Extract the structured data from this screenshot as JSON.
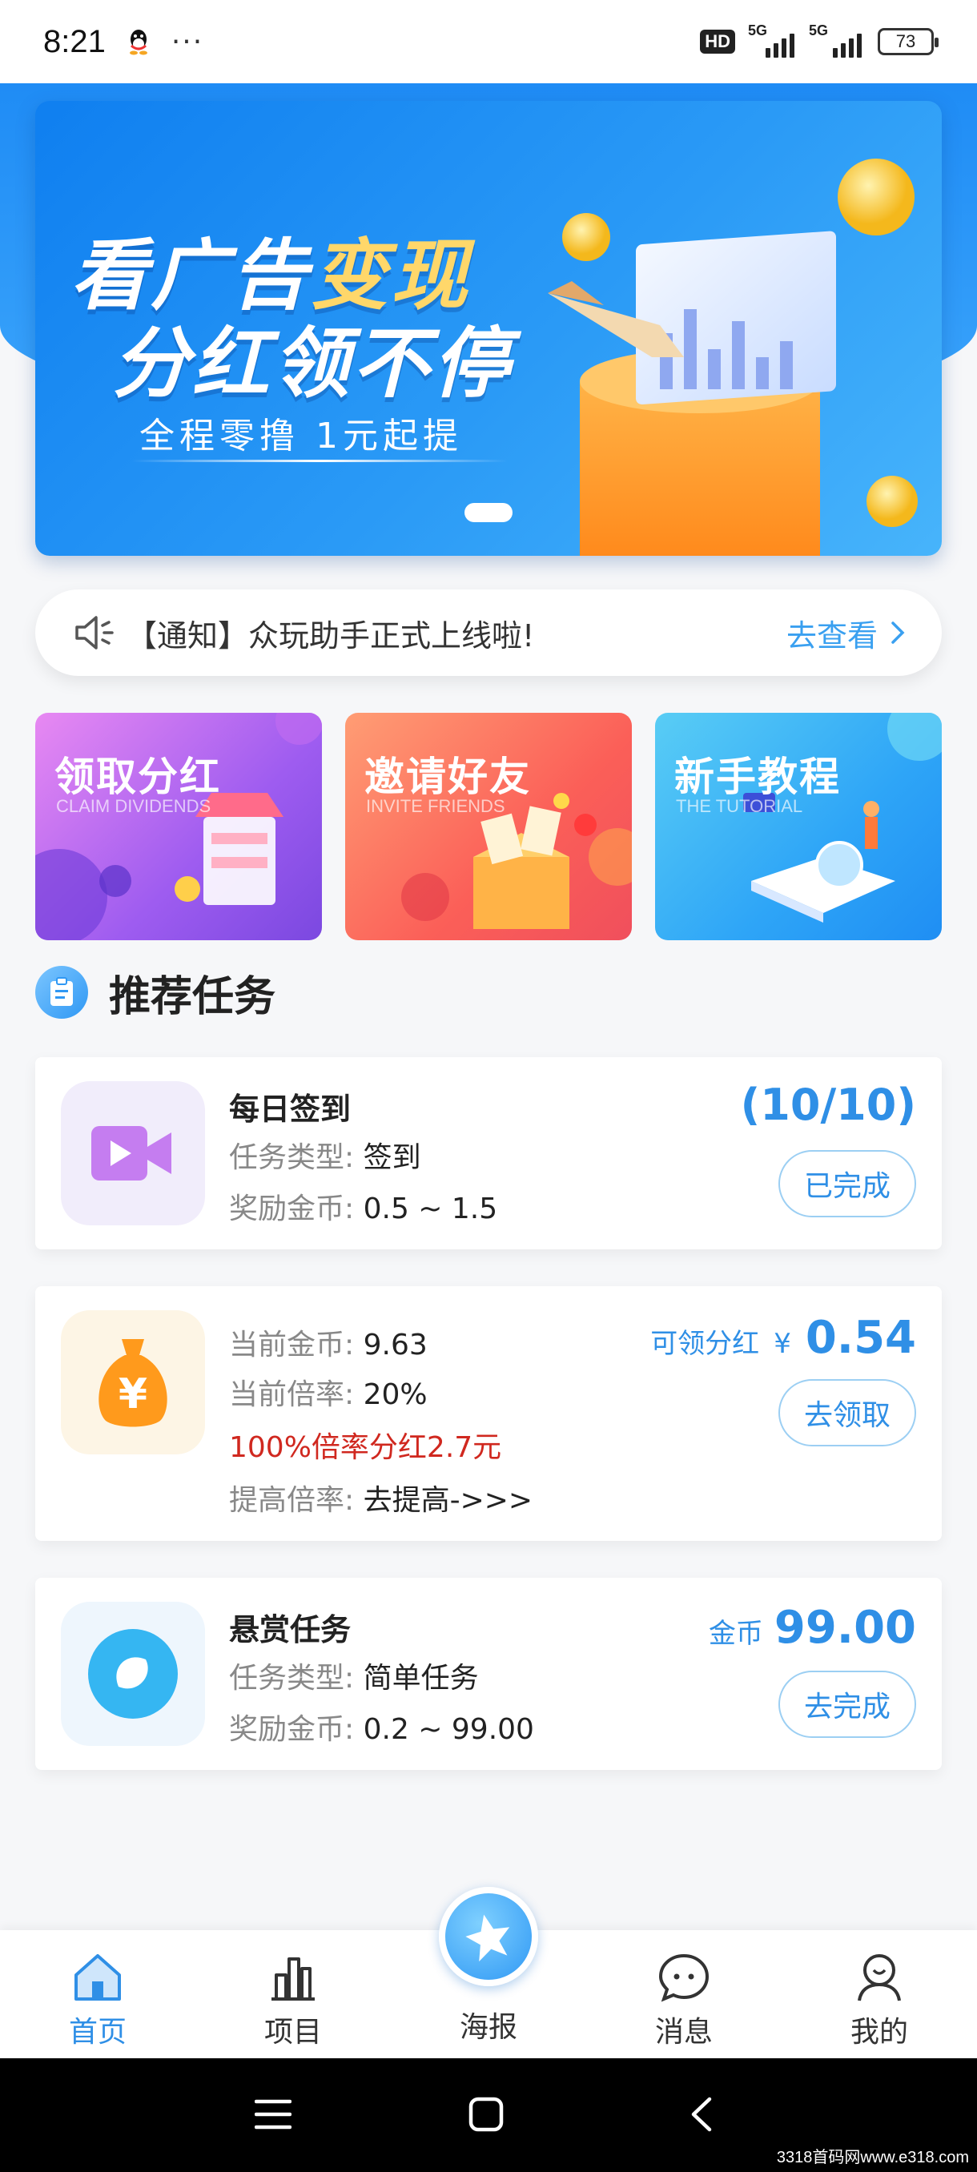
{
  "status_bar": {
    "time": "8:21",
    "more": "···",
    "hd": "HD",
    "net1": "5G",
    "net2": "5G",
    "battery": "73"
  },
  "banner": {
    "title_line1_a": "看广告",
    "title_line1_b": "变现",
    "title_line2": "分红领不停",
    "subtitle": "全程零撸 1元起提"
  },
  "notice": {
    "text": "【通知】众玩助手正式上线啦!",
    "link": "去查看"
  },
  "features": [
    {
      "title": "领取分红",
      "subtitle": "CLAIM DIVIDENDS"
    },
    {
      "title": "邀请好友",
      "subtitle": "INVITE FRIENDS"
    },
    {
      "title": "新手教程",
      "subtitle": "THE TUTORIAL"
    }
  ],
  "section": {
    "title": "推荐任务"
  },
  "tasks": {
    "daily": {
      "name": "每日签到",
      "type_label": "任务类型:",
      "type_value": "签到",
      "reward_label": "奖励金币:",
      "reward_value": "0.5 ~ 1.5",
      "progress": "(10/10)",
      "button": "已完成"
    },
    "dividend": {
      "coins_label": "当前金币:",
      "coins_value": "9.63",
      "rate_label": "当前倍率:",
      "rate_value": "20%",
      "promo": "100%倍率分红2.7元",
      "boost_label": "提高倍率:",
      "boost_value": "去提高->>>",
      "claim_label": "可领分红",
      "currency": "¥",
      "claim_value": "0.54",
      "button": "去领取"
    },
    "bounty": {
      "name": "悬赏任务",
      "type_label": "任务类型:",
      "type_value": "简单任务",
      "reward_label": "奖励金币:",
      "reward_value": "0.2 ~ 99.00",
      "coin_label": "金币",
      "coin_value": "99.00",
      "button": "去完成"
    }
  },
  "bottom_nav": {
    "home": "首页",
    "projects": "项目",
    "poster": "海报",
    "messages": "消息",
    "mine": "我的"
  },
  "watermark": "3318首码网www.e318.com",
  "colors": {
    "brand_blue": "#2f8fe6",
    "promo_red": "#d0281f"
  }
}
